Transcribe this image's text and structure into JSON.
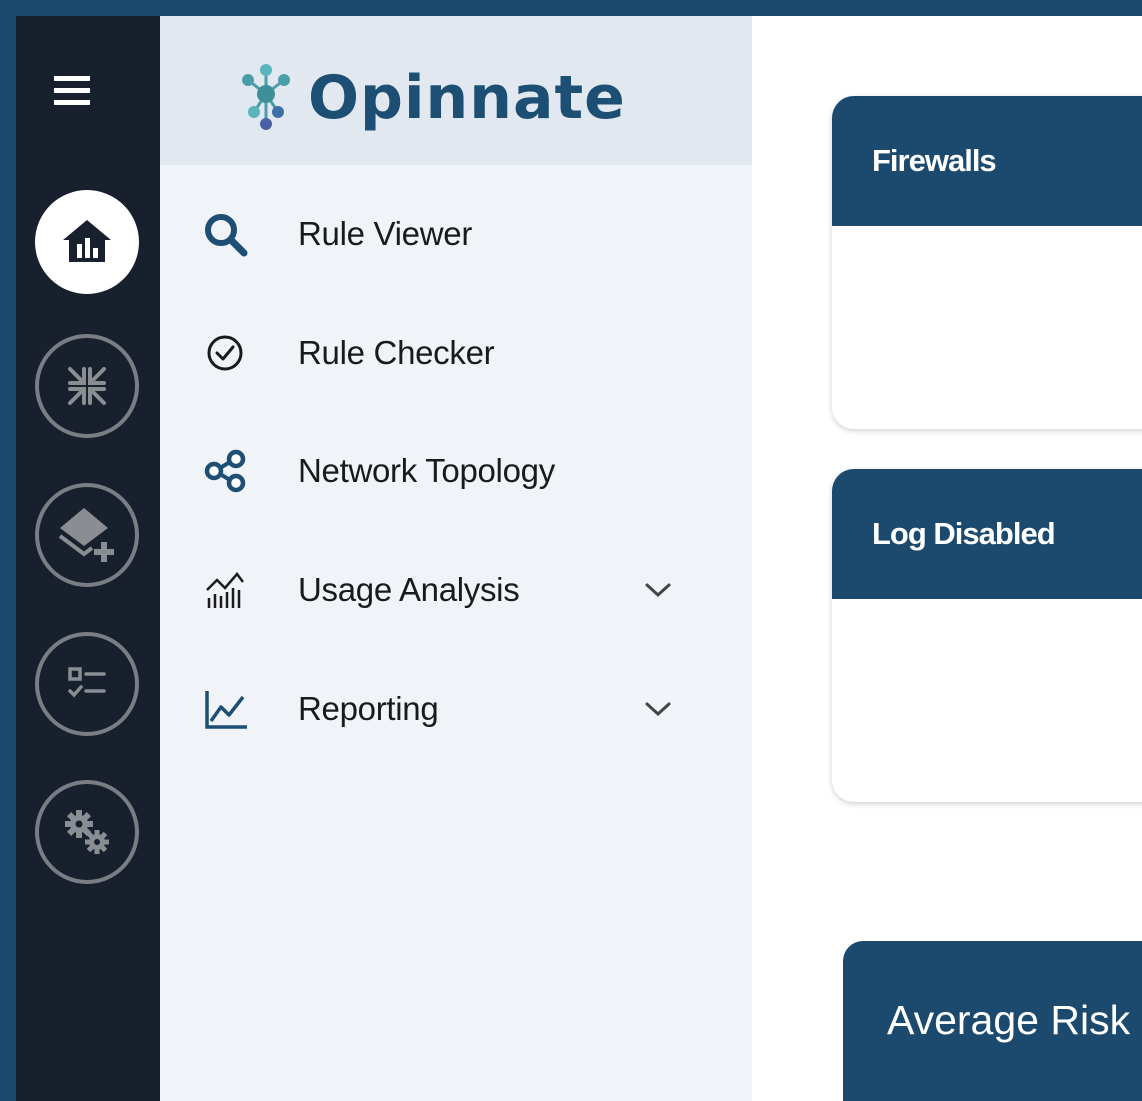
{
  "brand": {
    "name": "Opinnate",
    "primary_color": "#1b4a6e",
    "rail_color": "#17202c"
  },
  "rail": {
    "menu_icon": "hamburger-menu-icon",
    "buttons": [
      {
        "icon": "home-dashboard-icon",
        "active": true
      },
      {
        "icon": "compress-arrows-icon",
        "active": false
      },
      {
        "icon": "layers-add-icon",
        "active": false
      },
      {
        "icon": "checklist-icon",
        "active": false
      },
      {
        "icon": "gears-icon",
        "active": false
      }
    ]
  },
  "menu": {
    "items": [
      {
        "label": "Rule Viewer",
        "icon": "search-icon"
      },
      {
        "label": "Rule Checker",
        "icon": "check-circle-icon"
      },
      {
        "label": "Network Topology",
        "icon": "share-nodes-icon"
      },
      {
        "label": "Usage Analysis",
        "icon": "bar-chart-trend-icon",
        "expandable": true
      },
      {
        "label": "Reporting",
        "icon": "line-chart-icon",
        "expandable": true
      }
    ]
  },
  "cards": [
    {
      "title": "Firewalls"
    },
    {
      "title": "Log Disabled"
    }
  ],
  "risk_card": {
    "title": "Average Risk"
  }
}
